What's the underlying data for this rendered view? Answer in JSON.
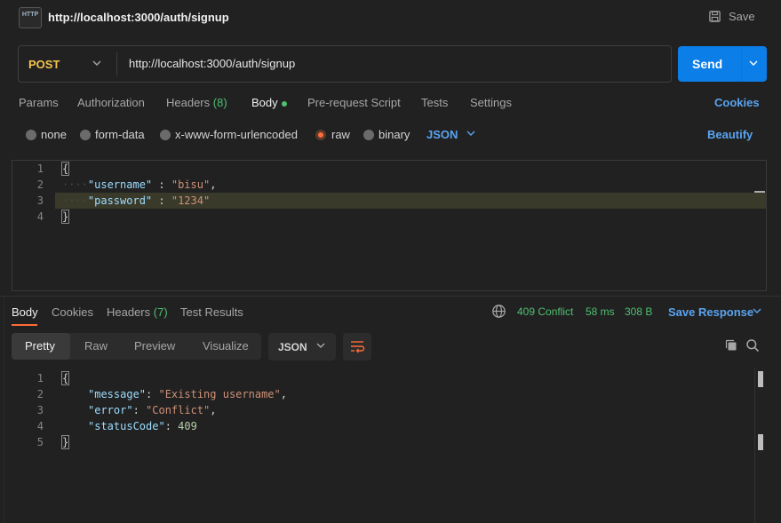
{
  "header": {
    "icon_text": "HTTP",
    "title": "http://localhost:3000/auth/signup",
    "save_label": "Save"
  },
  "request": {
    "method": "POST",
    "url": "http://localhost:3000/auth/signup",
    "send_label": "Send"
  },
  "tabs": [
    {
      "label": "Params"
    },
    {
      "label": "Authorization"
    },
    {
      "label": "Headers",
      "count": "(8)"
    },
    {
      "label": "Body"
    },
    {
      "label": "Pre-request Script"
    },
    {
      "label": "Tests"
    },
    {
      "label": "Settings"
    }
  ],
  "cookies_label": "Cookies",
  "body_options": [
    "none",
    "form-data",
    "x-www-form-urlencoded",
    "raw",
    "binary"
  ],
  "body_format": "JSON",
  "beautify_label": "Beautify",
  "request_body": {
    "line_numbers": [
      "1",
      "2",
      "3",
      "4"
    ],
    "open": "{",
    "close": "}",
    "k1": "\"username\"",
    "sep1": " : ",
    "v1": "\"bisu\"",
    "c1": ",",
    "k2": "\"password\"",
    "sep2": " : ",
    "v2": "\"1234\""
  },
  "response_tabs": [
    {
      "label": "Body"
    },
    {
      "label": "Cookies"
    },
    {
      "label": "Headers",
      "count": "(7)"
    },
    {
      "label": "Test Results"
    }
  ],
  "response_meta": {
    "status": "409 Conflict",
    "time": "58 ms",
    "size": "308 B",
    "save_label": "Save Response"
  },
  "view_modes": [
    "Pretty",
    "Raw",
    "Preview",
    "Visualize"
  ],
  "response_format": "JSON",
  "response_body": {
    "line_numbers": [
      "1",
      "2",
      "3",
      "4",
      "5"
    ],
    "open": "{",
    "close": "}",
    "k1": "\"message\"",
    "v1": "\"Existing username\"",
    "k2": "\"error\"",
    "v2": "\"Conflict\"",
    "k3": "\"statusCode\"",
    "v3": "409"
  },
  "colors": {
    "accent": "#ff6c37",
    "primary": "#0b7ee8",
    "link": "#5aa4f0",
    "success": "#4fbf70",
    "method": "#f4c44e"
  }
}
